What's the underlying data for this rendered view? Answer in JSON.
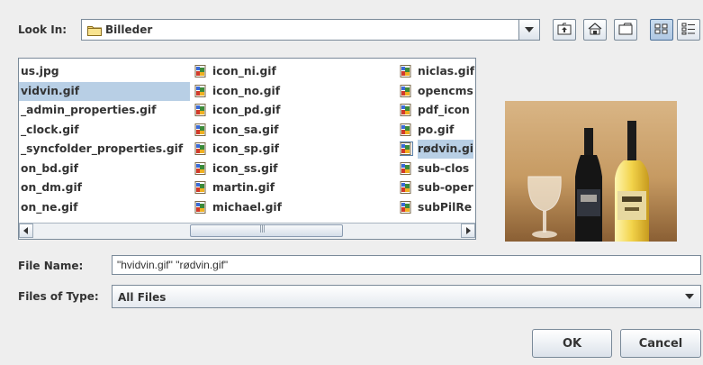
{
  "look_in": {
    "label": "Look In:",
    "value": "Billeder"
  },
  "toolbar": {
    "up_folder": "up-one-level",
    "home": "home",
    "new_folder": "new-folder",
    "list_view": "list-view",
    "details_view": "details-view"
  },
  "files": {
    "column1": [
      {
        "name": "us.jpg",
        "selected": false
      },
      {
        "name": "vidvin.gif",
        "selected": true
      },
      {
        "name": "_admin_properties.gif",
        "selected": false
      },
      {
        "name": "_clock.gif",
        "selected": false
      },
      {
        "name": "_syncfolder_properties.gif",
        "selected": false
      },
      {
        "name": "on_bd.gif",
        "selected": false
      },
      {
        "name": "on_dm.gif",
        "selected": false
      },
      {
        "name": "on_ne.gif",
        "selected": false
      }
    ],
    "column2": [
      {
        "name": "icon_ni.gif"
      },
      {
        "name": "icon_no.gif"
      },
      {
        "name": "icon_pd.gif"
      },
      {
        "name": "icon_sa.gif"
      },
      {
        "name": "icon_sp.gif"
      },
      {
        "name": "icon_ss.gif"
      },
      {
        "name": "martin.gif"
      },
      {
        "name": "michael.gif"
      }
    ],
    "column3": [
      {
        "name": "niclas.gif",
        "selected": false
      },
      {
        "name": "opencms",
        "selected": false
      },
      {
        "name": "pdf_icon",
        "selected": false
      },
      {
        "name": "po.gif",
        "selected": false
      },
      {
        "name": "rødvin.gi",
        "selected": true
      },
      {
        "name": "sub-clos",
        "selected": false
      },
      {
        "name": "sub-oper",
        "selected": false
      },
      {
        "name": "subPilRe",
        "selected": false
      }
    ]
  },
  "file_name": {
    "label": "File Name:",
    "value": "\"hvidvin.gif\" \"rødvin.gif\""
  },
  "file_type": {
    "label": "Files of Type:",
    "value": "All Files"
  },
  "buttons": {
    "ok": "OK",
    "cancel": "Cancel"
  },
  "colors": {
    "selection": "#b8cfe5",
    "border": "#7a8a99",
    "background": "#eeeeee"
  }
}
